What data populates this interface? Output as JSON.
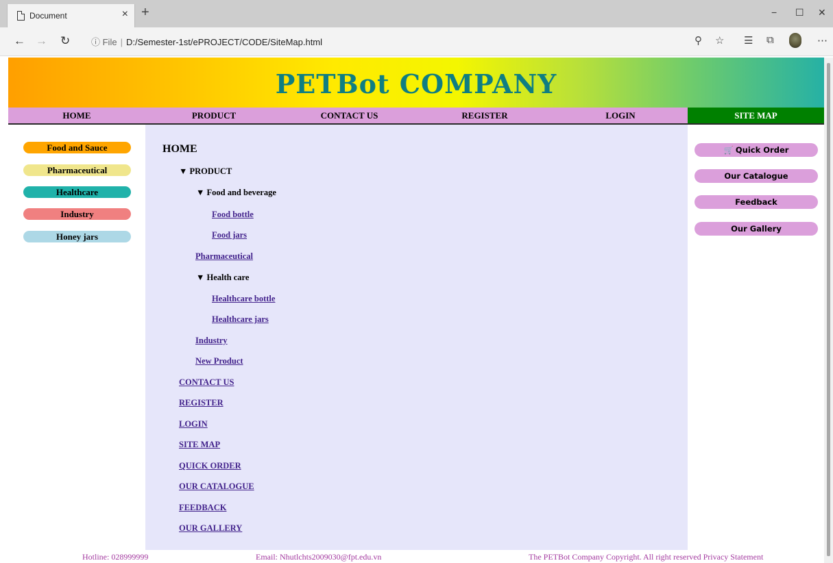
{
  "browser": {
    "tab_title": "Document",
    "tab_close": "×",
    "new_tab": "+",
    "url_info": "ⓘ File",
    "url_path": "D:/Semester-1st/ePROJECT/CODE/SiteMap.html",
    "window_controls": [
      "−",
      "☐",
      "✕"
    ],
    "nav_icons": [
      "back-icon",
      "forward-icon",
      "refresh-icon"
    ],
    "toolbar_icons": [
      "zoom-icon",
      "favorite-star-icon",
      "favorites-list-icon",
      "collections-icon",
      "profile-icon",
      "more-icon"
    ]
  },
  "header": {
    "title": "PETBot COMPANY"
  },
  "topnav": [
    "HOME",
    "PRODUCT",
    "CONTACT US",
    "REGISTER",
    "LOGIN",
    "SITE MAP"
  ],
  "sidebar_left": [
    {
      "label": "Food and Sauce",
      "color": "#ffa500"
    },
    {
      "label": "Pharmaceutical",
      "color": "#f0e68c"
    },
    {
      "label": "Healthcare",
      "color": "#20b2aa"
    },
    {
      "label": "Industry",
      "color": "#f08080"
    },
    {
      "label": "Honey jars",
      "color": "#add8e6"
    }
  ],
  "sidebar_right": [
    "Quick Order",
    "Our Catalogue",
    "Feedback",
    "Our Gallery"
  ],
  "sitemap": {
    "home": "HOME",
    "product": "▼ PRODUCT",
    "food_beverage": "▼ Food and beverage",
    "food_bottle": "Food bottle",
    "food_jars": "Food jars",
    "pharmaceutical": "Pharmaceutical",
    "health_care": "▼ Health care",
    "healthcare_bottle": "Healthcare bottle",
    "healthcare_jars": "Healthcare jars",
    "industry": "Industry",
    "new_product": "New Product",
    "contact_us": "CONTACT US",
    "register": "REGISTER",
    "login": "LOGIN",
    "site_map": "SITE MAP",
    "quick_order": "QUICK ORDER",
    "our_catalogue": "OUR CATALOGUE",
    "feedback": "FEEDBACK",
    "our_gallery": "OUR GALLERY"
  },
  "footer": {
    "hotline": "Hotline: 028999999",
    "email": "Email: Nhutlchts2009030@fpt.edu.vn",
    "copyright": "The PETBot Company Copyright. All right reserved Privacy Statement"
  }
}
